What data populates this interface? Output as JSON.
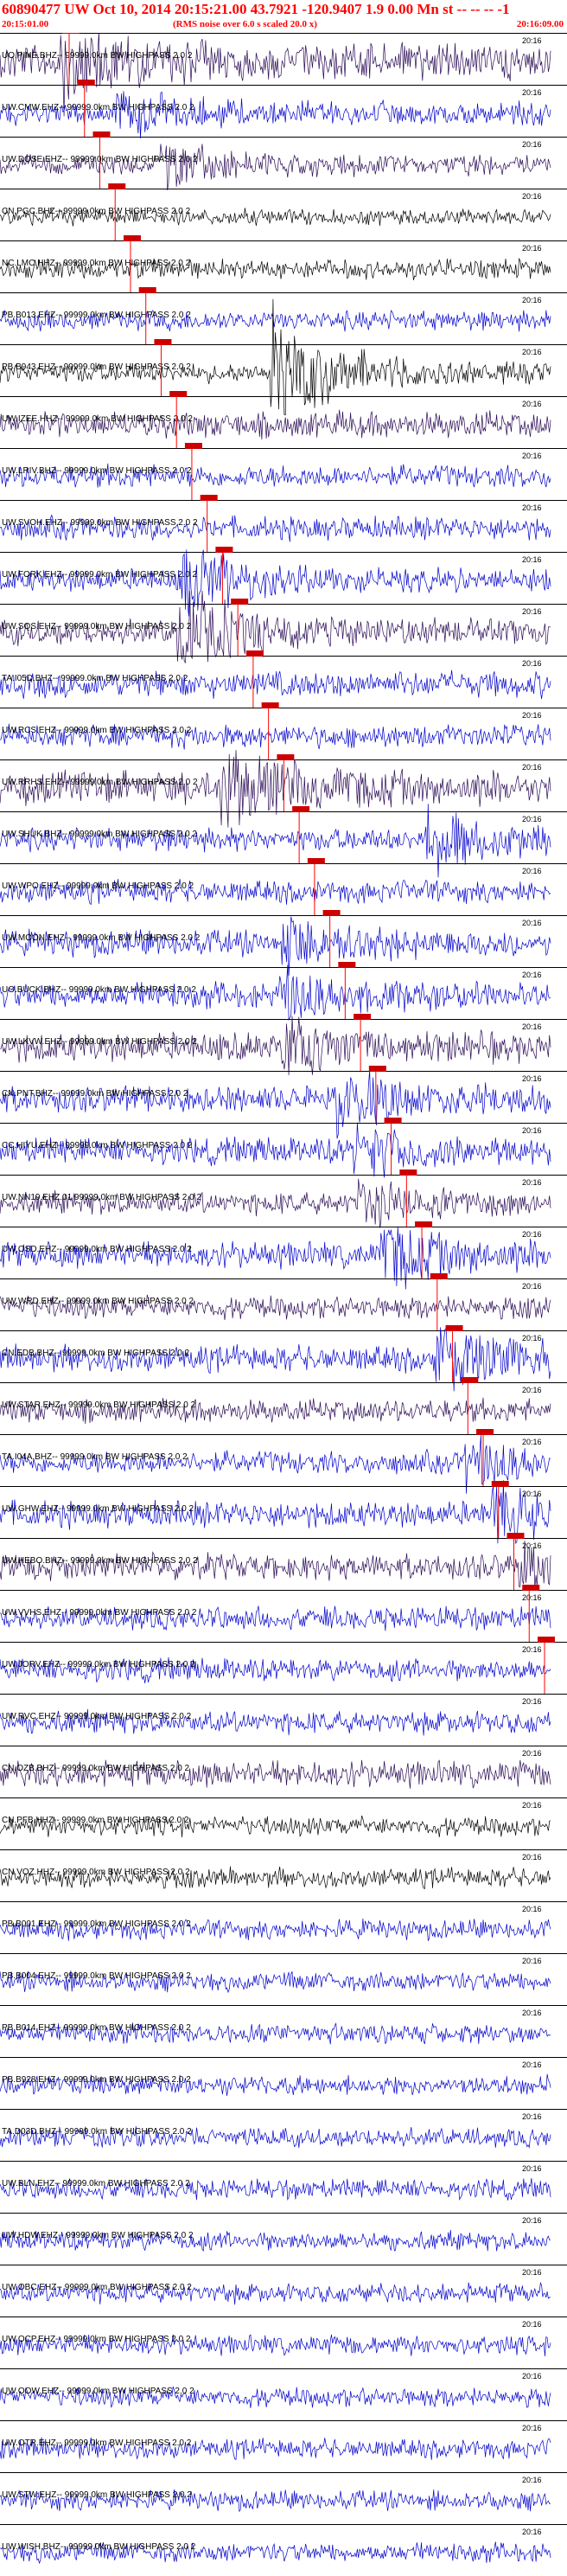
{
  "header": {
    "title": "60890477 UW Oct 10, 2014 20:15:21.00   43.7921 -120.9407  1.9 0.00 Mn st -- -- -- -1",
    "start_time": "20:15:01.00",
    "rms_note": "(RMS noise over 6.0 s scaled 20.0 x)",
    "end_time": "20:16:09.00"
  },
  "end_marker": "20:16",
  "colors": {
    "black": "#000000",
    "blue": "#0000cc",
    "purple": "#2a0a55",
    "pick": "#cc0000",
    "marker": "#ff0000"
  },
  "traces": [
    {
      "label": "UO.PINE.BHZ-- 99999.0km BW  HIGHPASS  2.0  2",
      "color": "purple",
      "amp": 0.55,
      "ev": 0.12,
      "ea": 1.0
    },
    {
      "label": "UW.CMW.EHZ-- 99999.0km BW  HIGHPASS  2.0  2",
      "color": "blue",
      "amp": 0.35,
      "ev": 0.22,
      "ea": 0.5
    },
    {
      "label": "UW.DOSE.EHZ-- 99999.0km BW  HIGHPASS  2.0  2",
      "color": "purple",
      "amp": 0.3,
      "ev": 0.3,
      "ea": 0.6
    },
    {
      "label": "CN.PGC.BHZ-- 99999.0km BW  HIGHPASS  2.0  2",
      "color": "black",
      "amp": 0.25,
      "ev": 0,
      "ea": 0
    },
    {
      "label": "NC.LMC.HHZ-- 99999.0km BW  HIGHPASS  2.0  2",
      "color": "black",
      "amp": 0.3,
      "ev": 0,
      "ea": 0
    },
    {
      "label": "PB.B013.EHZ-- 99999.0km BW  HIGHPASS  2.0  2",
      "color": "blue",
      "amp": 0.3,
      "ev": 0,
      "ea": 0
    },
    {
      "label": "PB.B943.EHZ-- 99999.0km BW  HIGHPASS  2.0  2",
      "color": "black",
      "amp": 0.3,
      "ev": 0.5,
      "ea": 1.6
    },
    {
      "label": "UW.IZEE.HHZ-- 99999.0km BW  HIGHPASS  2.0  2",
      "color": "purple",
      "amp": 0.4,
      "ev": 0,
      "ea": 0
    },
    {
      "label": "UW.LRIV.BHZ-- 99999.0km BW  HIGHPASS  2.0  2",
      "color": "blue",
      "amp": 0.35,
      "ev": 0,
      "ea": 0
    },
    {
      "label": "UW.SVOH.EHZ-- 99999.0km BW  HIGHPASS  2.0  2",
      "color": "blue",
      "amp": 0.35,
      "ev": 0,
      "ea": 0
    },
    {
      "label": "UW.FORK.EHZ-- 99999.0km BW  HIGHPASS  2.0  2",
      "color": "blue",
      "amp": 0.35,
      "ev": 0.34,
      "ea": 0.9
    },
    {
      "label": "UW.SQS.EHZ-- 99999.0km BW  HIGHPASS  2.0  2",
      "color": "purple",
      "amp": 0.4,
      "ev": 0.33,
      "ea": 1.0
    },
    {
      "label": "TA.I05D.BHZ-- 99999.0km BW  HIGHPASS  2.0  2",
      "color": "blue",
      "amp": 0.4,
      "ev": 0,
      "ea": 0
    },
    {
      "label": "UW.RCS.EHZ-- 99999.0km BW  HIGHPASS  2.0  2",
      "color": "blue",
      "amp": 0.35,
      "ev": 0,
      "ea": 0
    },
    {
      "label": "UW.RRHS.EHZ-- 99999.0km BW  HIGHPASS  2.0  2",
      "color": "purple",
      "amp": 0.5,
      "ev": 0.41,
      "ea": 1.0
    },
    {
      "label": "UW.SHUK.BHZ-- 99999.0km BW  HIGHPASS  2.0  2",
      "color": "blue",
      "amp": 0.35,
      "ev": 0.78,
      "ea": 0.8
    },
    {
      "label": "UW.WPO.EHZ-- 99999.0km BW  HIGHPASS  2.0  2",
      "color": "blue",
      "amp": 0.35,
      "ev": 0,
      "ea": 0
    },
    {
      "label": "UW.MOON.EHZ-- 99999.0km BW  HIGHPASS  2.0  2",
      "color": "blue",
      "amp": 0.4,
      "ev": 0.52,
      "ea": 0.6
    },
    {
      "label": "UO.BUCK.BHZ-- 99999.0km BW  HIGHPASS  2.0  2",
      "color": "blue",
      "amp": 0.4,
      "ev": 0.51,
      "ea": 0.6
    },
    {
      "label": "UW.LKVW.EHZ-- 99999.0km BW  HIGHPASS  2.0  2",
      "color": "purple",
      "amp": 0.45,
      "ev": 0.52,
      "ea": 0.7
    },
    {
      "label": "CN.PNT.BHZ-- 99999.0km BW  HIGHPASS  2.0  2",
      "color": "blue",
      "amp": 0.4,
      "ev": 0.62,
      "ea": 0.8
    },
    {
      "label": "CC.HIYU.EHZ-- 99999.0km BW  HIGHPASS  2.0  2",
      "color": "blue",
      "amp": 0.4,
      "ev": 0.65,
      "ea": 0.6
    },
    {
      "label": "UW.NN19.EHZ.01 99999.0km BW  HIGHPASS  2.0  2",
      "color": "purple",
      "amp": 0.35,
      "ev": 0.66,
      "ea": 0.5
    },
    {
      "label": "UW.OSD.EHZ-- 99999.0km BW  HIGHPASS  2.0  2",
      "color": "blue",
      "amp": 0.4,
      "ev": 0.7,
      "ea": 0.8
    },
    {
      "label": "UW.WRD.EHZ-- 99999.0km BW  HIGHPASS  2.0  2",
      "color": "purple",
      "amp": 0.35,
      "ev": 0,
      "ea": 0
    },
    {
      "label": "CN.EDB.BHZ-- 99999.0km BW  HIGHPASS  2.0  2",
      "color": "blue",
      "amp": 0.4,
      "ev": 0.8,
      "ea": 1.0
    },
    {
      "label": "UW.STAR.EHZ-- 99999.0km BW  HIGHPASS  2.0  2",
      "color": "purple",
      "amp": 0.35,
      "ev": 0,
      "ea": 0
    },
    {
      "label": "TA.I04A.BHZ-- 99999.0km BW  HIGHPASS  2.0  2",
      "color": "blue",
      "amp": 0.35,
      "ev": 0.85,
      "ea": 0.6
    },
    {
      "label": "UW.GHW.EHZ-- 99999.0km BW  HIGHPASS  2.0  2",
      "color": "blue",
      "amp": 0.4,
      "ev": 0.9,
      "ea": 0.7
    },
    {
      "label": "UW.HEBO.BHZ-- 99999.0km BW  HIGHPASS  2.0  2",
      "color": "purple",
      "amp": 0.4,
      "ev": 0.95,
      "ea": 0.5
    },
    {
      "label": "UW.VVHS.EHZ-- 99999.0km BW  HIGHPASS  2.0  2",
      "color": "blue",
      "amp": 0.35,
      "ev": 0,
      "ea": 0
    },
    {
      "label": "UW.JORV.EHZ-- 99999.0km BW  HIGHPASS  2.0  2",
      "color": "blue",
      "amp": 0.35,
      "ev": 0,
      "ea": 0
    },
    {
      "label": "UW.RVC.EHZ-- 99999.0km BW  HIGHPASS  2.0  2",
      "color": "blue",
      "amp": 0.35,
      "ev": 0,
      "ea": 0
    },
    {
      "label": "CN.OZB.BHZ-- 99999.0km BW  HIGHPASS  2.0  2",
      "color": "purple",
      "amp": 0.4,
      "ev": 0,
      "ea": 0
    },
    {
      "label": "CN.PFB.HHZ-- 99999.0km BW  HIGHPASS  2.0  2",
      "color": "black",
      "amp": 0.3,
      "ev": 0,
      "ea": 0
    },
    {
      "label": "CN.VOZ.HHZ-- 99999.0km BW  HIGHPASS  2.0  2",
      "color": "black",
      "amp": 0.3,
      "ev": 0,
      "ea": 0
    },
    {
      "label": "PB.B001.EHZ-- 99999.0km BW  HIGHPASS  2.0  2",
      "color": "blue",
      "amp": 0.3,
      "ev": 0,
      "ea": 0
    },
    {
      "label": "PB.B004.EHZ-- 99999.0km BW  HIGHPASS  2.0  2",
      "color": "blue",
      "amp": 0.3,
      "ev": 0,
      "ea": 0
    },
    {
      "label": "PB.B014.EHZ-- 99999.0km BW  HIGHPASS  2.0  2",
      "color": "blue",
      "amp": 0.3,
      "ev": 0,
      "ea": 0
    },
    {
      "label": "PB.B928.EHZ-- 99999.0km BW  HIGHPASS  2.0  2",
      "color": "blue",
      "amp": 0.3,
      "ev": 0,
      "ea": 0
    },
    {
      "label": "TA.D03D.BHZ-- 99999.0km BW  HIGHPASS  2.0  2",
      "color": "blue",
      "amp": 0.3,
      "ev": 0,
      "ea": 0
    },
    {
      "label": "UW.BLN.EHZ-- 99999.0km BW  HIGHPASS  2.0  2",
      "color": "blue",
      "amp": 0.3,
      "ev": 0,
      "ea": 0
    },
    {
      "label": "UW.HDW.EHZ-- 99999.0km BW  HIGHPASS  2.0  2",
      "color": "blue",
      "amp": 0.3,
      "ev": 0,
      "ea": 0
    },
    {
      "label": "UW.OBC.EHZ-- 99999.0km BW  HIGHPASS  2.0  2",
      "color": "blue",
      "amp": 0.3,
      "ev": 0,
      "ea": 0
    },
    {
      "label": "UW.OCP.EHZ-- 99999.0km BW  HIGHPASS  2.0  2",
      "color": "blue",
      "amp": 0.3,
      "ev": 0,
      "ea": 0
    },
    {
      "label": "UW.OOW.EHZ-- 99999.0km BW  HIGHPASS  2.0  2",
      "color": "blue",
      "amp": 0.3,
      "ev": 0,
      "ea": 0
    },
    {
      "label": "UW.OTR.EHZ-- 99999.0km BW  HIGHPASS  2.0  2",
      "color": "blue",
      "amp": 0.3,
      "ev": 0,
      "ea": 0
    },
    {
      "label": "UW.STW.EHZ-- 99999.0km BW  HIGHPASS  2.0  2",
      "color": "blue",
      "amp": 0.3,
      "ev": 0,
      "ea": 0
    },
    {
      "label": "UW.WISH.BHZ-- 99999.0km BW  HIGHPASS  2.0  2",
      "color": "blue",
      "amp": 0.3,
      "ev": 0,
      "ea": 0
    }
  ]
}
